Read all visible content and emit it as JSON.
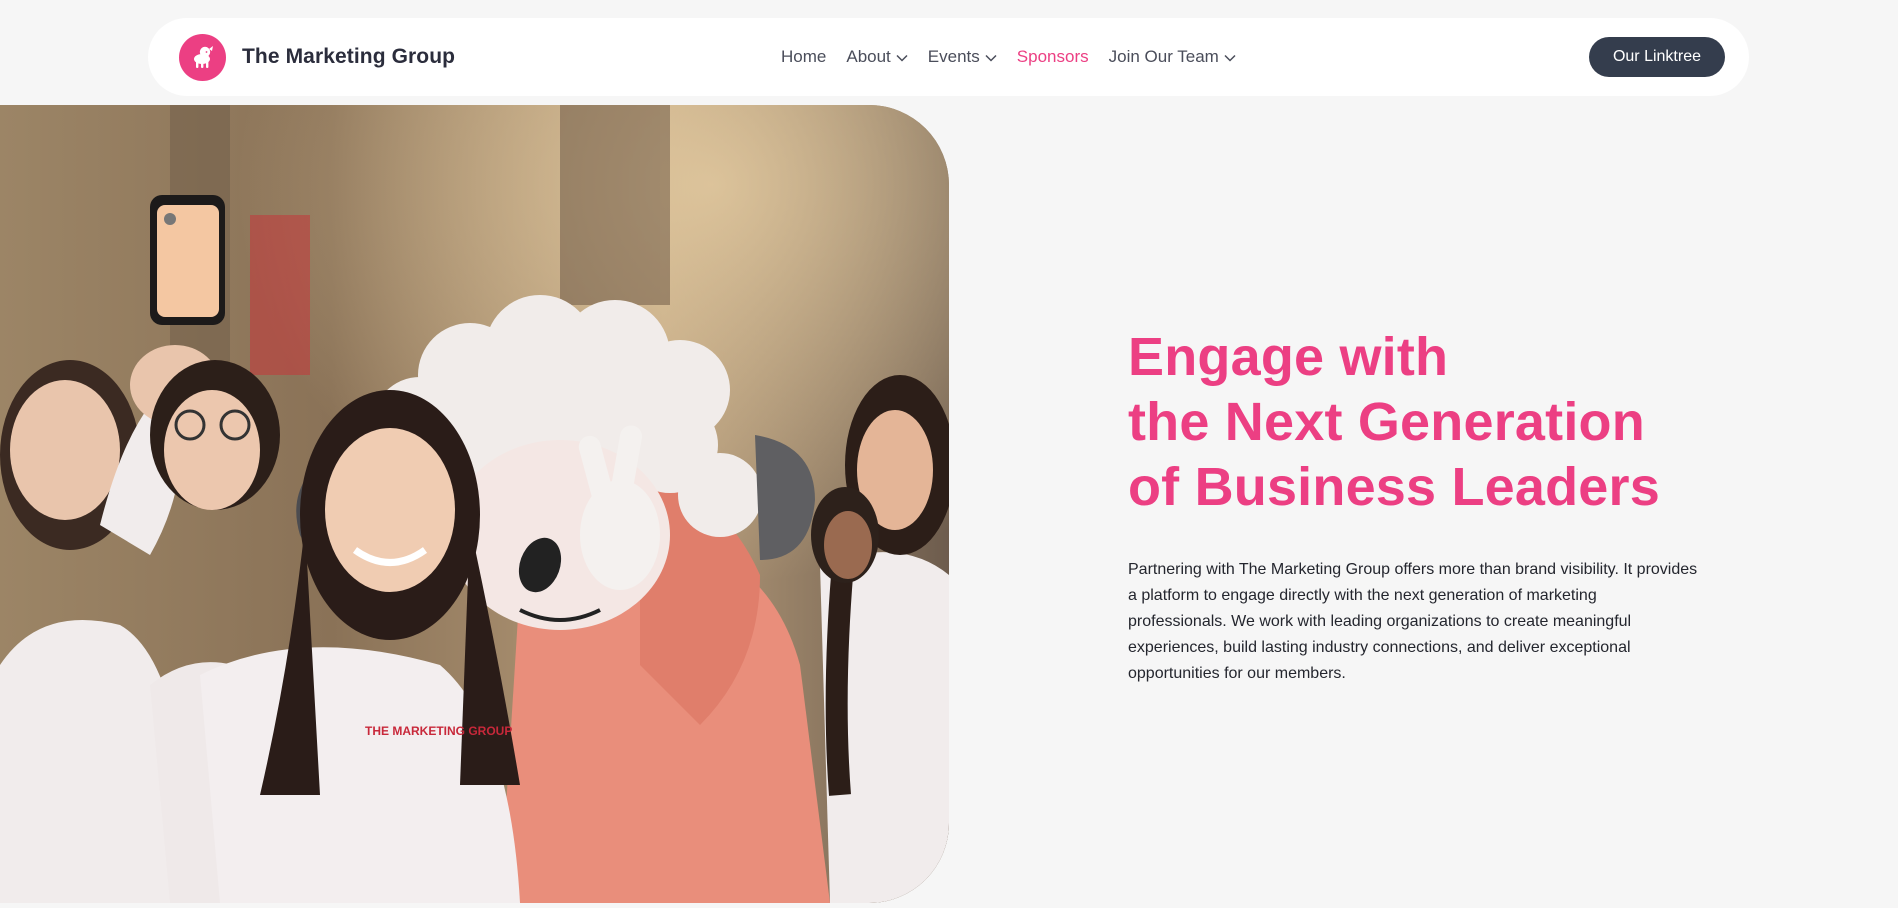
{
  "brand": {
    "name": "The Marketing Group",
    "color": "#ec3f83"
  },
  "nav": {
    "items": [
      {
        "label": "Home",
        "has_dropdown": false,
        "active": false
      },
      {
        "label": "About",
        "has_dropdown": true,
        "active": false
      },
      {
        "label": "Events",
        "has_dropdown": true,
        "active": false
      },
      {
        "label": "Sponsors",
        "has_dropdown": false,
        "active": true
      },
      {
        "label": "Join Our Team",
        "has_dropdown": true,
        "active": false
      }
    ],
    "cta_label": "Our Linktree"
  },
  "hero": {
    "title_lines": [
      "Engage with",
      "the Next Generation",
      "of Business Leaders"
    ],
    "body": "Partnering with The Marketing Group offers more than brand visibility. It provides a platform to engage directly with the next generation of marketing professionals. We work with leading organizations to create meaningful experiences, build lasting industry connections, and deliver exceptional opportunities for our members.",
    "image_alt": "Students taking a selfie with the sheep mascot"
  },
  "colors": {
    "accent": "#ec3f83",
    "cta_bg": "#343d4d",
    "page_bg": "#f6f6f6"
  }
}
